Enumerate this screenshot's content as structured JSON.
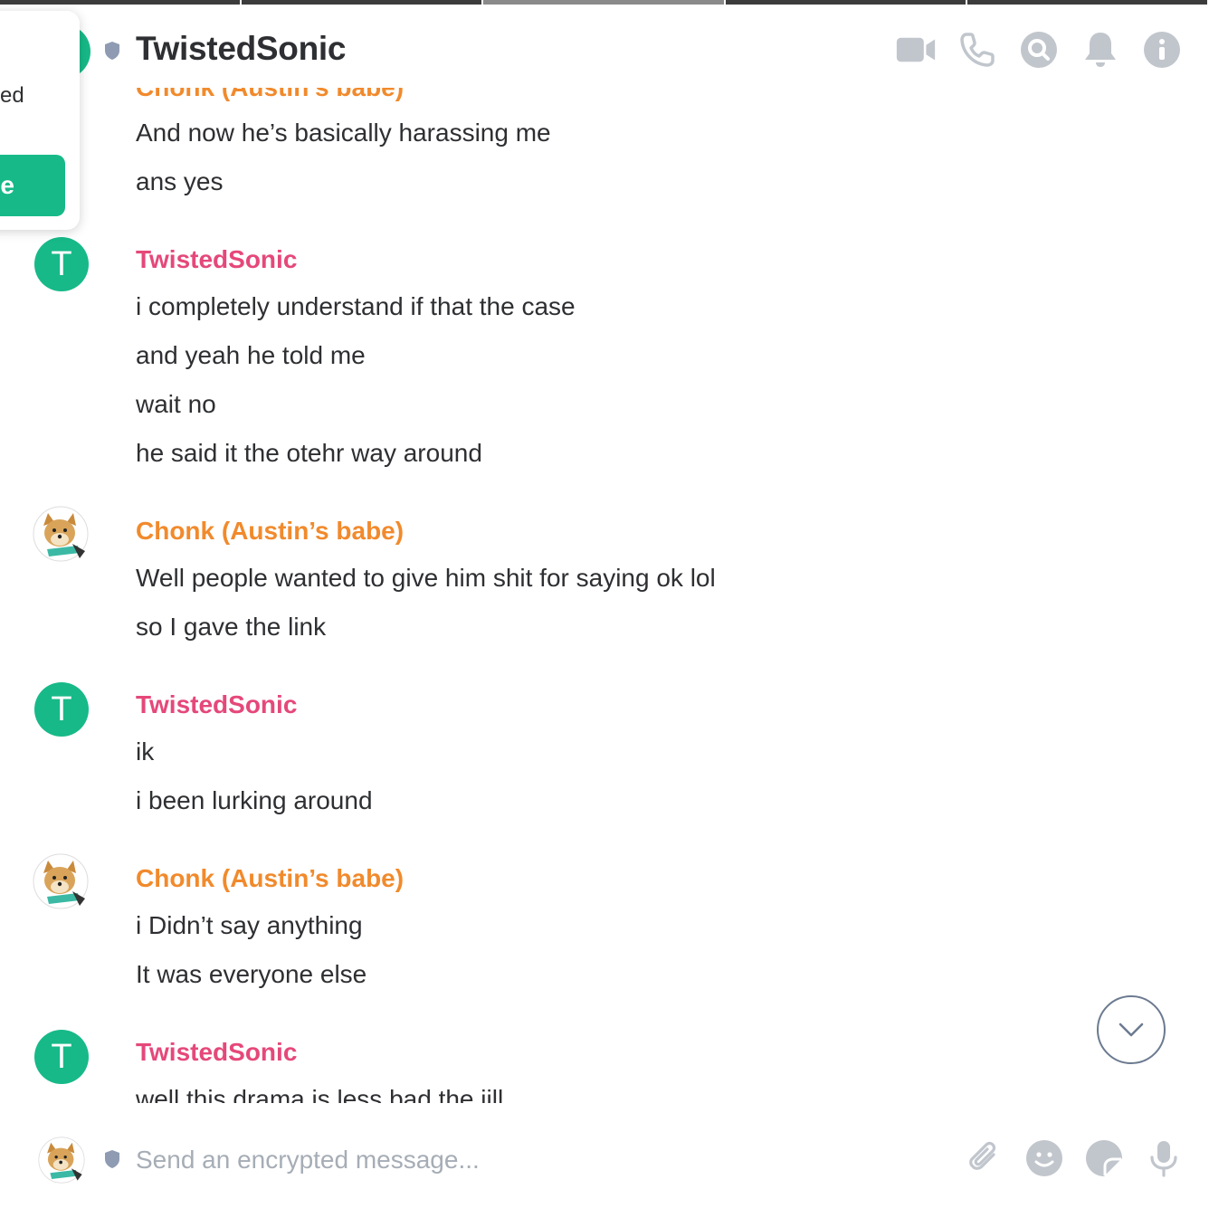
{
  "header": {
    "room_name": "TwistedSonic"
  },
  "popup": {
    "text": "ed",
    "button_label": "ue"
  },
  "timeline": {
    "partial_sender": "Chonk (Austin’s babe)",
    "groups": [
      {
        "sender": "",
        "messages": [
          "And now he’s basically harassing me",
          "ans yes"
        ]
      },
      {
        "sender": "TwistedSonic",
        "avatar_letter": "T",
        "messages": [
          "i completely understand if that  the case",
          "and yeah he told me",
          "wait no",
          "he said it the otehr way around"
        ]
      },
      {
        "sender": "Chonk (Austin’s babe)",
        "messages": [
          "Well people wanted to give him shit for saying ok lol",
          "so I gave the link"
        ]
      },
      {
        "sender": "TwistedSonic",
        "avatar_letter": "T",
        "messages": [
          "ik",
          "i been lurking around"
        ]
      },
      {
        "sender": "Chonk (Austin’s babe)",
        "messages": [
          "i Didn’t say anything",
          "It was everyone else"
        ]
      },
      {
        "sender": "TwistedSonic",
        "avatar_letter": "T",
        "messages": [
          "well this drama is less bad the iill"
        ]
      }
    ]
  },
  "composer": {
    "placeholder": "Send an encrypted message..."
  },
  "colors": {
    "accent_green": "#17b988",
    "sender_pink": "#e5487a",
    "sender_orange": "#f18a2c",
    "icon_gray": "#c1c6cd"
  }
}
